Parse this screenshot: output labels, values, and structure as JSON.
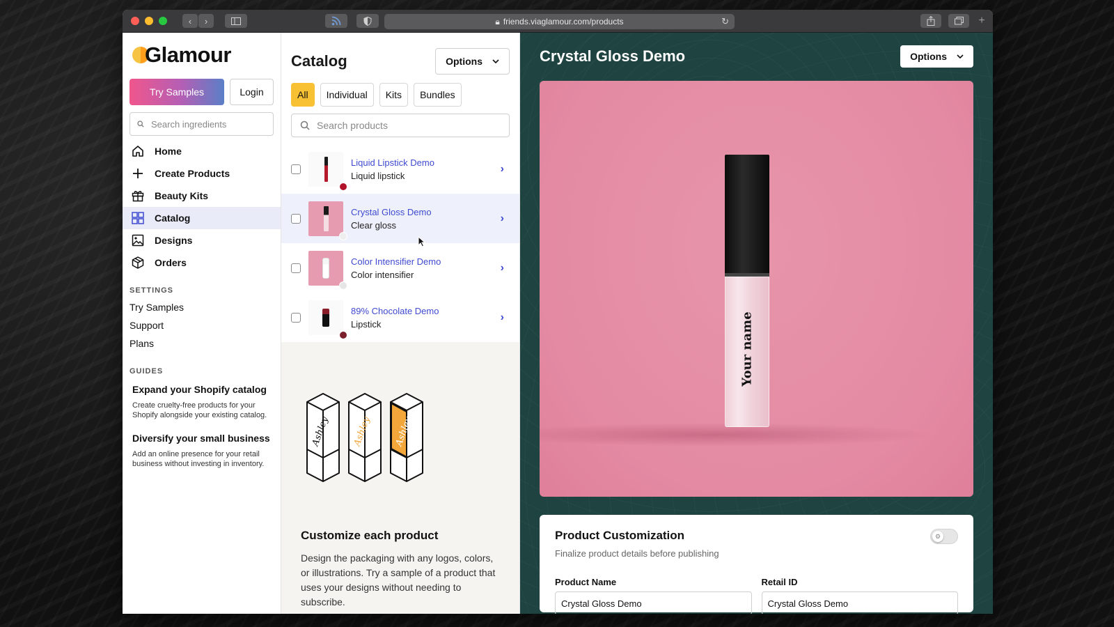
{
  "browser": {
    "url": "friends.viaglamour.com/products"
  },
  "sidebar": {
    "logo_text": "Glamour",
    "try_samples_label": "Try Samples",
    "login_label": "Login",
    "search_placeholder": "Search ingredients",
    "nav_items": [
      {
        "label": "Home",
        "icon": "home-icon"
      },
      {
        "label": "Create Products",
        "icon": "plus-icon"
      },
      {
        "label": "Beauty Kits",
        "icon": "gift-icon"
      },
      {
        "label": "Catalog",
        "icon": "grid-icon",
        "active": true
      },
      {
        "label": "Designs",
        "icon": "image-icon"
      },
      {
        "label": "Orders",
        "icon": "box-icon"
      }
    ],
    "settings_title": "SETTINGS",
    "settings_links": [
      "Try Samples",
      "Support",
      "Plans"
    ],
    "guides_title": "GUIDES",
    "guides": [
      {
        "title": "Expand your Shopify catalog",
        "desc": "Create cruelty-free products for your Shopify alongside your existing catalog."
      },
      {
        "title": "Diversify your small business",
        "desc": "Add an online presence for your retail business without investing in inventory."
      }
    ]
  },
  "catalog": {
    "title": "Catalog",
    "options_label": "Options",
    "filters": [
      "All",
      "Individual",
      "Kits",
      "Bundles"
    ],
    "active_filter": "All",
    "search_placeholder": "Search products",
    "products": [
      {
        "name": "Liquid Lipstick Demo",
        "type": "Liquid lipstick",
        "swatch": "#b0132a"
      },
      {
        "name": "Crystal Gloss Demo",
        "type": "Clear gloss",
        "swatch": "#eeeeee",
        "active": true
      },
      {
        "name": "Color Intensifier Demo",
        "type": "Color intensifier",
        "swatch": "#e6e6e6"
      },
      {
        "name": "89% Chocolate Demo",
        "type": "Lipstick",
        "swatch": "#7a1f2b"
      }
    ],
    "promo_title": "Customize each product",
    "promo_desc": "Design the packaging with any logos, colors, or illustrations. Try a sample of a product that uses your designs without needing to subscribe."
  },
  "detail": {
    "title": "Crystal Gloss Demo",
    "options_label": "Options",
    "tube_label": "Your name",
    "customization_title": "Product Customization",
    "customization_sub": "Finalize product details before publishing",
    "product_name_label": "Product Name",
    "product_name_value": "Crystal Gloss Demo",
    "retail_id_label": "Retail ID",
    "retail_id_value": "Crystal Gloss Demo"
  },
  "colors": {
    "accent": "#3f4ad1",
    "filter_active": "#f7c133",
    "detail_bg": "#1e4340",
    "hero_bg": "#e48aa3"
  }
}
